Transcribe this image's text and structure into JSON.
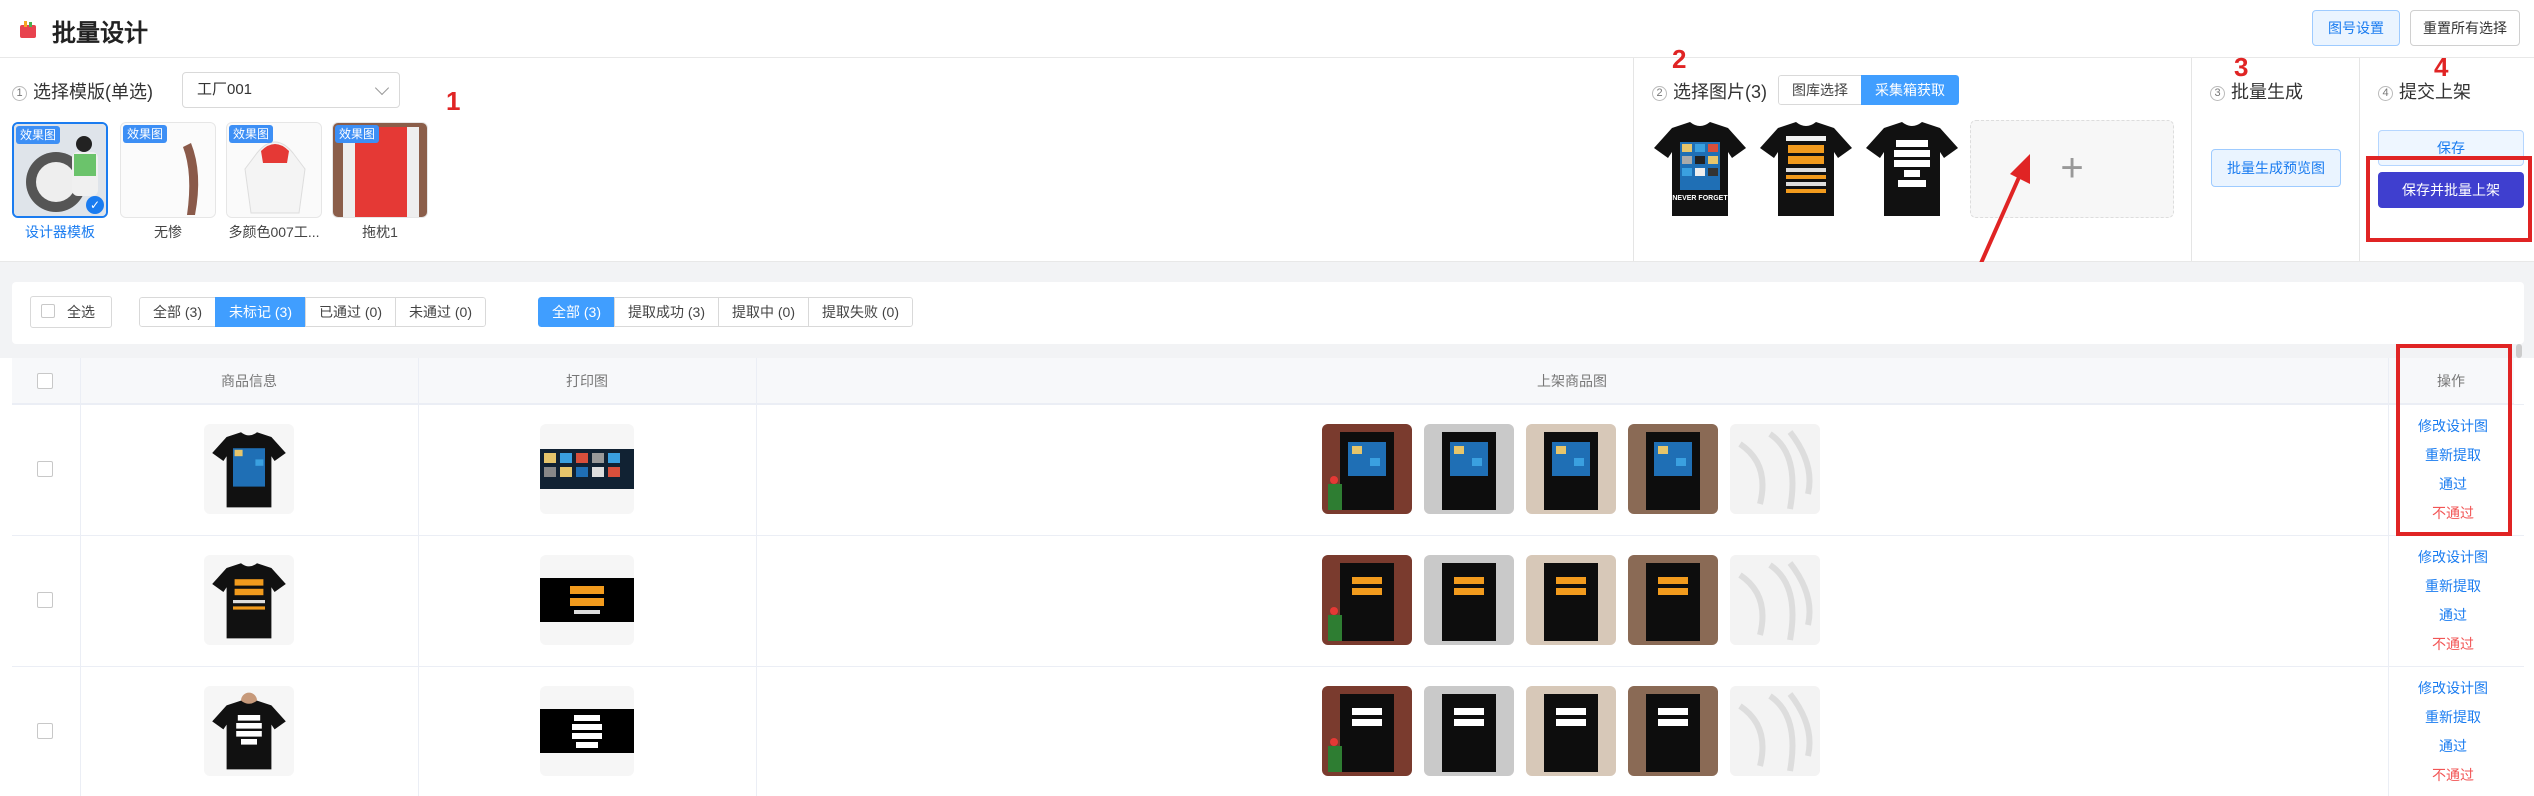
{
  "header": {
    "title": "批量设计",
    "id_settings_label": "图号设置",
    "reset_label": "重置所有选择"
  },
  "sections": {
    "s1": {
      "step": "1",
      "title": "选择模版(单选)",
      "annotation": "1",
      "factory": "工厂001"
    },
    "s2": {
      "step": "2",
      "title": "选择图片(3)",
      "annotation": "2",
      "tabs": [
        "图库选择",
        "采集箱获取"
      ],
      "active_tab": 1
    },
    "s3": {
      "step": "3",
      "title": "批量生成",
      "annotation": "3",
      "button": "批量生成预览图"
    },
    "s4": {
      "step": "4",
      "title": "提交上架",
      "annotation": "4",
      "save": "保存",
      "save_list": "保存并批量上架"
    }
  },
  "templates": [
    {
      "badge": "效果图",
      "label": "设计器模板",
      "selected": true
    },
    {
      "badge": "效果图",
      "label": "无惨",
      "selected": false
    },
    {
      "badge": "效果图",
      "label": "多颜色007工...",
      "selected": false
    },
    {
      "badge": "效果图",
      "label": "拖枕1",
      "selected": false
    }
  ],
  "selected_pictures": [
    {
      "text": "NEVER FORGET"
    },
    {
      "text": "I WANT TO BE SO FULL OF CHRIST THAT WHEN MOSQUITOES BITE ME THEY SING THERE IS POWER IN THE BLOOD"
    },
    {
      "text": "ADD YOUR IMAGE OR TEXT"
    }
  ],
  "filters": {
    "select_all": "全选",
    "mark_tabs": [
      "全部 (3)",
      "未标记 (3)",
      "已通过 (0)",
      "未通过 (0)"
    ],
    "mark_active": 1,
    "extract_tabs": [
      "全部 (3)",
      "提取成功 (3)",
      "提取中 (0)",
      "提取失败 (0)"
    ],
    "extract_active": 0
  },
  "table": {
    "columns": [
      "商品信息",
      "打印图",
      "上架商品图",
      "操作"
    ],
    "actions": [
      "修改设计图",
      "重新提取",
      "通过",
      "不通过"
    ],
    "rows": [
      {
        "design": "NEVER FORGET"
      },
      {
        "design": "FULL OF CHRIST"
      },
      {
        "design": "ADD YOUR IMAGE OR TEXT"
      }
    ]
  },
  "colors": {
    "primary": "#409eff",
    "danger": "#f25555",
    "annotation_red": "#e02424",
    "save_list_bg": "#3f3fcf"
  }
}
